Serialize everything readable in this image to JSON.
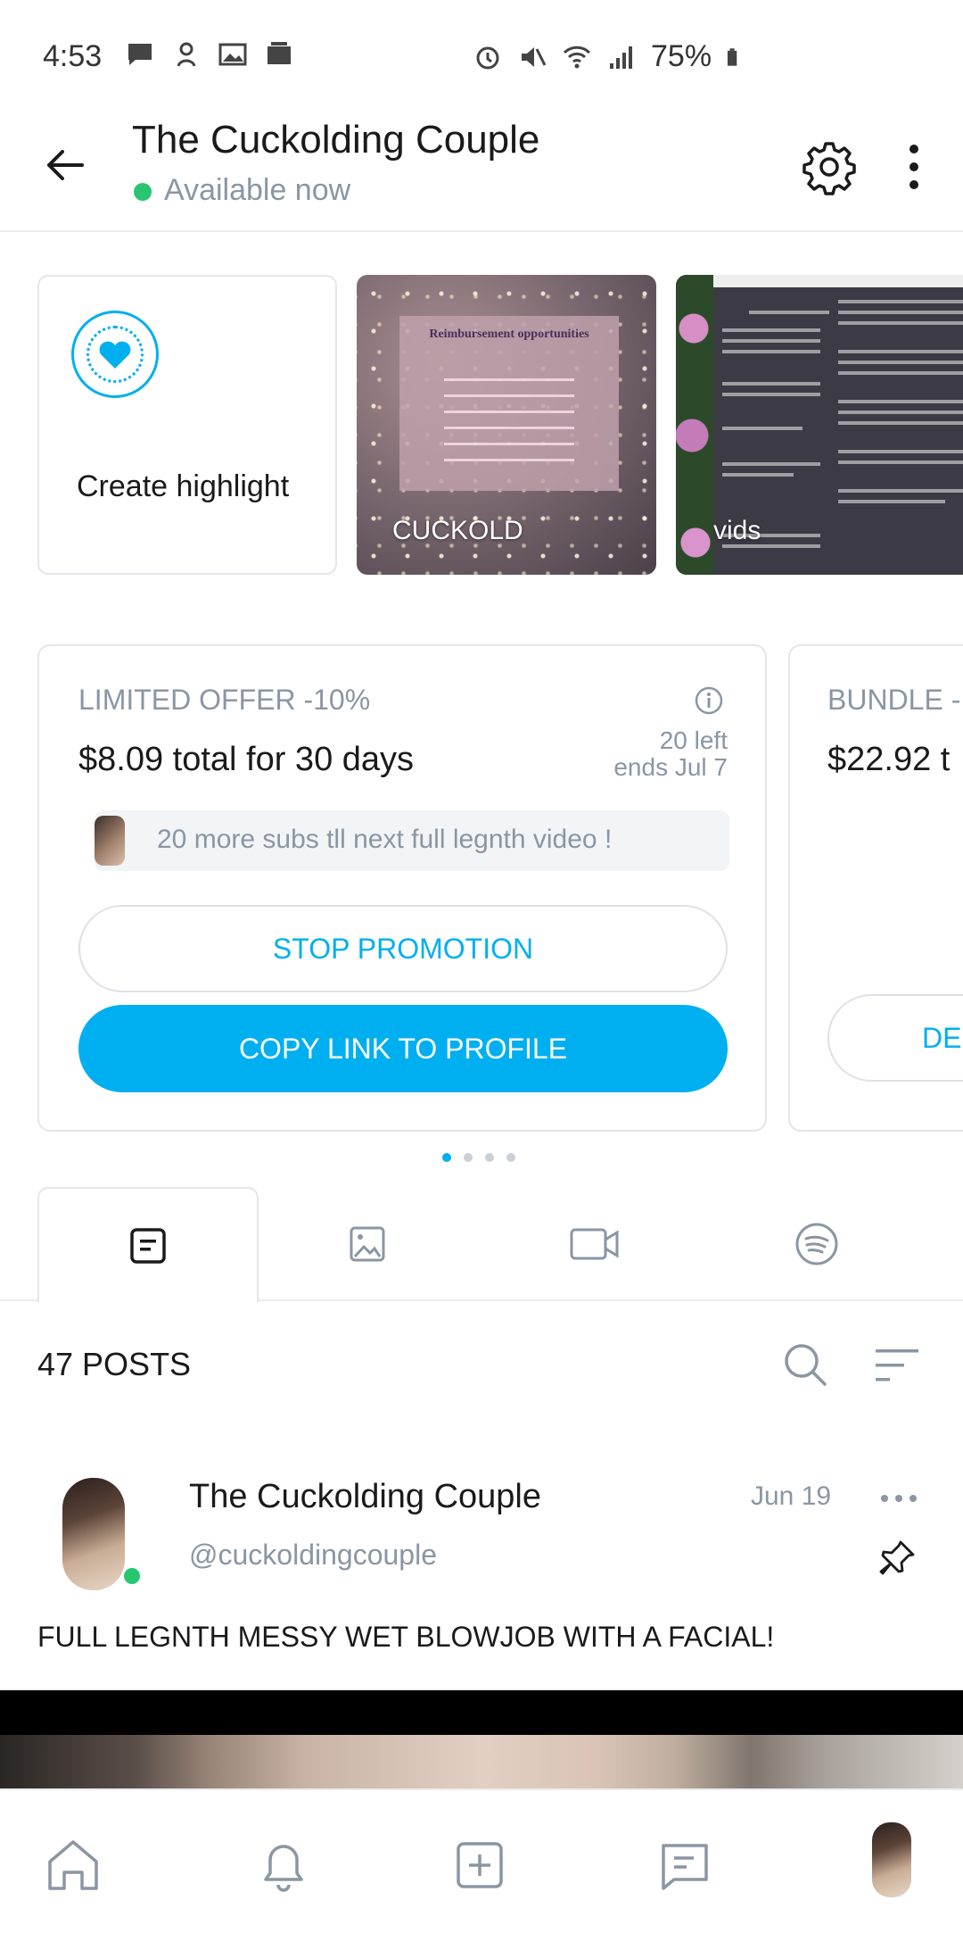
{
  "status_bar": {
    "time": "4:53",
    "battery": "75%"
  },
  "header": {
    "title": "The Cuckolding Couple",
    "status": "Available now"
  },
  "highlights": {
    "create_label": "Create highlight",
    "items": [
      {
        "label": "CUCKOLD",
        "poster_title": "Reimbursement opportunities"
      },
      {
        "label": "vids"
      }
    ]
  },
  "offer": {
    "title": "LIMITED OFFER -10%",
    "price": "$8.09 total for 30 days",
    "left": "20 left",
    "ends": "ends Jul 7",
    "message": "20 more subs tll next full legnth video !",
    "stop_label": "STOP PROMOTION",
    "copy_label": "COPY LINK TO PROFILE"
  },
  "bundle": {
    "title": "BUNDLE -",
    "price": "$22.92 t",
    "button_label": "DE"
  },
  "carousel": {
    "pages": 4,
    "active": 1
  },
  "tabs": [
    {
      "icon": "posts-icon",
      "active": true
    },
    {
      "icon": "photo-icon",
      "active": false
    },
    {
      "icon": "video-icon",
      "active": false
    },
    {
      "icon": "audio-icon",
      "active": false
    }
  ],
  "posts": {
    "count_label": "47 POSTS"
  },
  "post": {
    "name": "The Cuckolding Couple",
    "handle": "@cuckoldingcouple",
    "date": "Jun 19",
    "text": "FULL LEGNTH MESSY WET BLOWJOB WITH A FACIAL!"
  },
  "bottom_nav": [
    "home-icon",
    "bell-icon",
    "add-post-icon",
    "messages-icon",
    "profile-avatar"
  ],
  "colors": {
    "accent": "#00aff0",
    "online": "#28c76f",
    "muted": "#8a96a3"
  }
}
